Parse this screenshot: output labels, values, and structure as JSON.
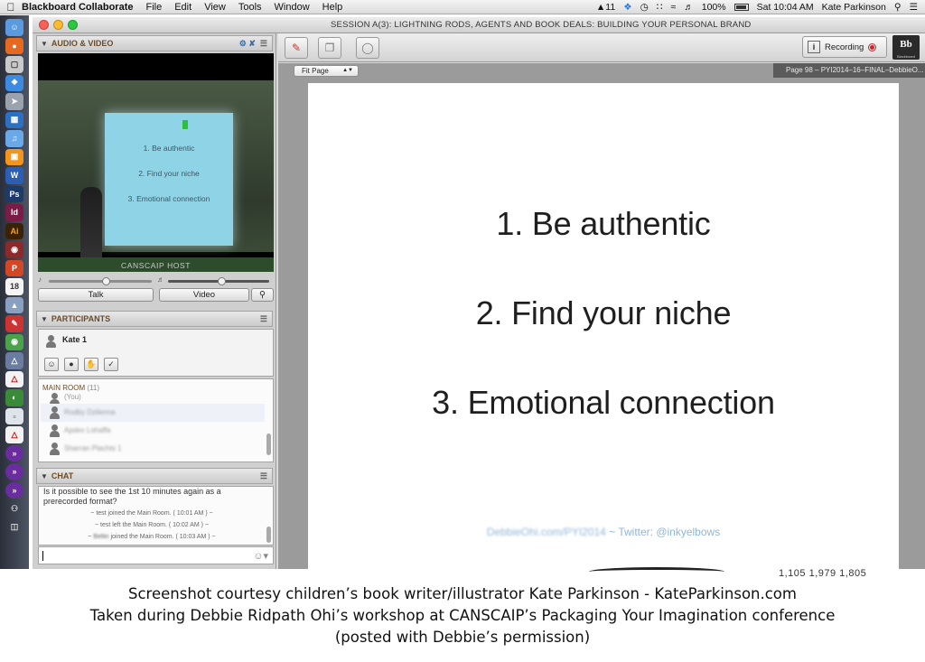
{
  "menubar": {
    "apple_icon": "apple-logo",
    "app_name": "Blackboard Collaborate",
    "menus": [
      "File",
      "Edit",
      "View",
      "Tools",
      "Window",
      "Help"
    ],
    "status_text": "11",
    "battery": "100%",
    "clock": "Sat 10:04 AM",
    "user": "Kate Parkinson"
  },
  "window": {
    "title": "SESSION A(3): LIGHTNING RODS, AGENTS AND BOOK DEALS: BUILDING YOUR PERSONAL BRAND"
  },
  "audio_video": {
    "header": "AUDIO & VIDEO",
    "video_caption": "CANSCAIP HOST",
    "projected_lines": [
      "1. Be authentic",
      "2. Find your niche",
      "3. Emotional connection"
    ],
    "mic_level": 0.55,
    "speaker_level": 0.53,
    "talk_label": "Talk",
    "video_label": "Video"
  },
  "participants": {
    "header": "PARTICIPANTS",
    "me": "Kate 1",
    "room_label": "MAIN ROOM",
    "room_count": "(11)",
    "rows": [
      "(You)",
      "Rodby Dzilenna",
      "Apdex Lohaffa",
      "Sharran Plachts 1"
    ]
  },
  "chat": {
    "header": "CHAT",
    "message": "Is it possible to see the 1st 10 minutes again as a prerecorded format?",
    "events": [
      {
        "pre": "~ test joined the Main Room. ( 10:01 AM ) ~",
        "name": ""
      },
      {
        "pre": "~ test left the Main Room. ( 10:02 AM ) ~",
        "name": ""
      },
      {
        "pre": "~",
        "name": "Bellin",
        "post": "joined the Main Room. ( 10:03 AM ) ~"
      }
    ]
  },
  "content": {
    "zoom": "Fit Page",
    "page_label": "Page 98 – PYI2014–16–FINAL–DebbieO...",
    "recording_label": "Recording",
    "bb_logo": "Bb",
    "bb_logo_small": "Blackboard",
    "slide_lines": [
      "1. Be authentic",
      "2. Find your niche",
      "3. Emotional connection"
    ],
    "credit_blurred": "DebbieOhi.com/PYI2014",
    "credit_clear": " ~ Twitter: @inkyelbows"
  },
  "behind": {
    "nums": "1,105   1,979   1,805"
  },
  "footer": {
    "line1": "Screenshot courtesy children’s book writer/illustrator Kate Parkinson - KateParkinson.com",
    "line2": "Taken during Debbie Ridpath Ohi’s workshop at CANSCAIP’s Packaging Your Imagination conference",
    "line3": "(posted with Debbie’s permission)"
  },
  "colors": {
    "panel_header_text": "#6b4b2a",
    "record_red": "#d8202a",
    "credit_blue": "#8fb6d8"
  }
}
